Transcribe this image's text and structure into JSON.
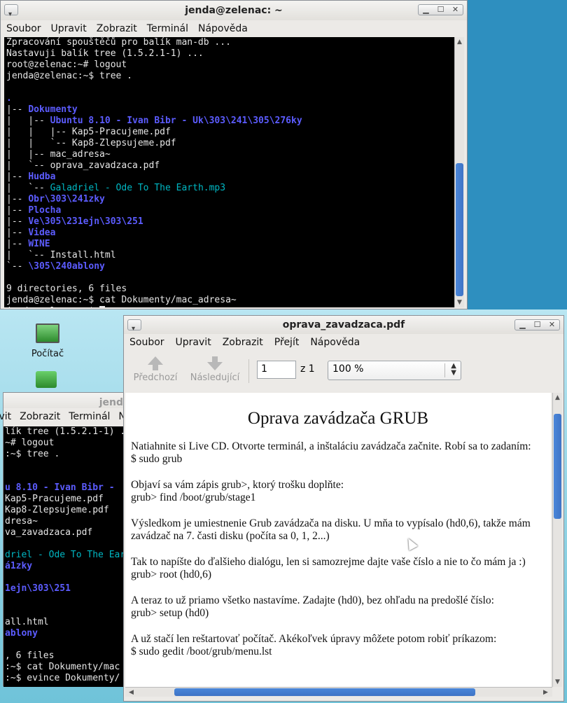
{
  "terminal_top": {
    "title": "jenda@zelenac: ~",
    "menu": [
      "Soubor",
      "Upravit",
      "Zobrazit",
      "Terminál",
      "Nápověda"
    ],
    "lines": [
      {
        "t": "Zpracování spouštěčů pro balík man-db ...",
        "c": ""
      },
      {
        "t": "Nastavuji balík tree (1.5.2.1-1) ...",
        "c": ""
      },
      {
        "t": "root@zelenac:~# logout",
        "c": ""
      },
      {
        "t": "jenda@zelenac:~$ tree .",
        "c": ""
      },
      {
        "t": "",
        "c": ""
      },
      {
        "t": ".",
        "c": "dir"
      },
      {
        "p": "|-- ",
        "t": "Dokumenty",
        "c": "dir"
      },
      {
        "p": "|   |-- ",
        "t": "Ubuntu 8.10 - Ivan Bibr - Uk\\303\\241\\305\\276ky",
        "c": "dir"
      },
      {
        "t": "|   |   |-- Kap5-Pracujeme.pdf",
        "c": ""
      },
      {
        "t": "|   |   `-- Kap8-Zlepsujeme.pdf",
        "c": ""
      },
      {
        "t": "|   |-- mac_adresa~",
        "c": ""
      },
      {
        "t": "|   `-- oprava_zavadzaca.pdf",
        "c": ""
      },
      {
        "p": "|-- ",
        "t": "Hudba",
        "c": "dir"
      },
      {
        "p": "|   `-- ",
        "t": "Galadriel - Ode To The Earth.mp3",
        "c": "music"
      },
      {
        "p": "|-- ",
        "t": "Obr\\303\\241zky",
        "c": "dir"
      },
      {
        "p": "|-- ",
        "t": "Plocha",
        "c": "dir"
      },
      {
        "p": "|-- ",
        "t": "Ve\\305\\231ejn\\303\\251",
        "c": "dir"
      },
      {
        "p": "|-- ",
        "t": "Videa",
        "c": "dir"
      },
      {
        "p": "|-- ",
        "t": "WINE",
        "c": "dir"
      },
      {
        "t": "|   `-- Install.html",
        "c": ""
      },
      {
        "p": "`-- ",
        "t": "\\305\\240ablony",
        "c": "dir"
      },
      {
        "t": "",
        "c": ""
      },
      {
        "t": "9 directories, 6 files",
        "c": ""
      },
      {
        "t": "jenda@zelenac:~$ cat Dokumenty/mac_adresa~",
        "c": ""
      },
      {
        "t": "jenda@zelenac:~$ ",
        "c": ""
      }
    ]
  },
  "terminal_back": {
    "title": "jend",
    "menu": [
      "Upravit",
      "Zobrazit",
      "Terminál",
      "N"
    ],
    "lines": [
      {
        "t": "lík tree (1.5.2.1-1) ...",
        "c": ""
      },
      {
        "t": "~# logout",
        "c": ""
      },
      {
        "t": ":~$ tree .",
        "c": ""
      },
      {
        "t": "",
        "c": ""
      },
      {
        "t": "",
        "c": ""
      },
      {
        "t": "u 8.10 - Ivan Bibr - ",
        "c": "dir"
      },
      {
        "t": "Kap5-Pracujeme.pdf",
        "c": ""
      },
      {
        "t": "Kap8-Zlepsujeme.pdf",
        "c": ""
      },
      {
        "t": "dresa~",
        "c": ""
      },
      {
        "t": "va_zavadzaca.pdf",
        "c": ""
      },
      {
        "t": "",
        "c": ""
      },
      {
        "t": "driel - Ode To The Ear",
        "c": "music"
      },
      {
        "t": "á1zky",
        "c": "dir"
      },
      {
        "t": "",
        "c": ""
      },
      {
        "t": "1ejn\\303\\251",
        "c": "dir"
      },
      {
        "t": "",
        "c": ""
      },
      {
        "t": "",
        "c": ""
      },
      {
        "t": "all.html",
        "c": ""
      },
      {
        "t": "ablony",
        "c": "dir"
      },
      {
        "t": "",
        "c": ""
      },
      {
        "t": ", 6 files",
        "c": ""
      },
      {
        "t": ":~$ cat Dokumenty/mac",
        "c": ""
      },
      {
        "t": ":~$ evince Dokumenty/",
        "c": ""
      }
    ]
  },
  "desktop": {
    "computer_label": "Počítač"
  },
  "pdf": {
    "title": "oprava_zavadzaca.pdf",
    "menu": [
      "Soubor",
      "Upravit",
      "Zobrazit",
      "Přejít",
      "Nápověda"
    ],
    "prev_label": "Předchozí",
    "next_label": "Následující",
    "page_value": "1",
    "page_total": "z 1",
    "zoom": "100 %",
    "heading": "Oprava zavádzača GRUB",
    "paragraphs": [
      [
        "Natiahnite si Live CD. Otvorte terminál, a inštaláciu zavádzača začnite. Robí sa to zadaním:",
        "$ sudo grub"
      ],
      [
        "Objaví sa vám zápis grub>, ktorý trošku doplňte:",
        "grub> find /boot/grub/stage1"
      ],
      [
        "Výsledkom je umiestnenie Grub zavádzača na disku. U mňa to vypísalo (hd0,6), takže mám",
        "zavádzač na 7. časti disku (počíta sa 0, 1, 2...)"
      ],
      [
        "Tak to napíšte do ďalšieho dialógu, len si samozrejme dajte vaše číslo a nie to čo mám ja :)",
        "grub> root (hd0,6)"
      ],
      [
        "A teraz to už priamo všetko nastavíme. Zadajte (hd0), bez ohľadu na predošlé číslo:",
        "grub> setup (hd0)"
      ],
      [
        "A už stačí len reštartovať počítač. Akékoľvek úpravy môžete potom robiť príkazom:",
        "$ sudo gedit /boot/grub/menu.lst"
      ]
    ]
  }
}
